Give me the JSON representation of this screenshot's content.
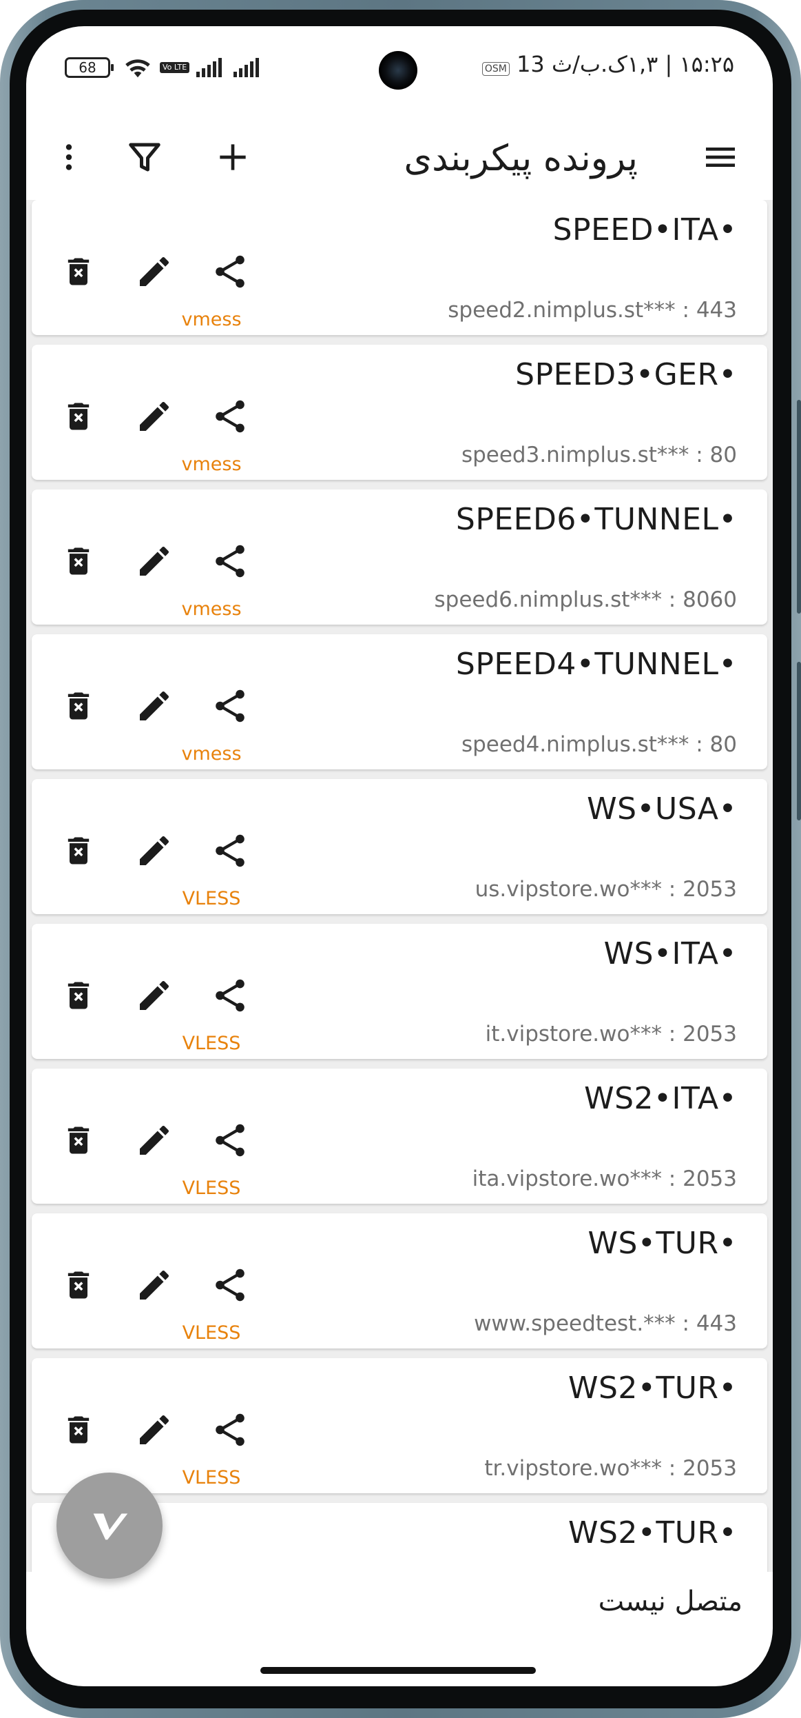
{
  "status_bar": {
    "battery": "68",
    "volte": "Vo LTE",
    "time_date": "۱۵:۲۵ | ۱,۳ک.ب/ث",
    "osm_badge": "OSM",
    "notif_count": "13"
  },
  "app_bar": {
    "title": "پرونده پیکربندی",
    "icons": [
      "menu-icon",
      "add-icon",
      "filter-icon",
      "more-vert-icon"
    ]
  },
  "servers": [
    {
      "name": "SPEED•ITA•",
      "address": "speed2.nimplus.st*** : 443",
      "type": "vmess"
    },
    {
      "name": "SPEED3•GER•",
      "address": "speed3.nimplus.st*** : 80",
      "type": "vmess"
    },
    {
      "name": "SPEED6•TUNNEL•",
      "address": "speed6.nimplus.st*** : 8060",
      "type": "vmess"
    },
    {
      "name": "SPEED4•TUNNEL•",
      "address": "speed4.nimplus.st*** : 80",
      "type": "vmess"
    },
    {
      "name": "WS•USA•",
      "address": "us.vipstore.wo*** : 2053",
      "type": "VLESS"
    },
    {
      "name": "WS•ITA•",
      "address": "it.vipstore.wo*** : 2053",
      "type": "VLESS"
    },
    {
      "name": "WS2•ITA•",
      "address": "ita.vipstore.wo*** : 2053",
      "type": "VLESS"
    },
    {
      "name": "WS•TUR•",
      "address": "www.speedtest.*** : 443",
      "type": "VLESS"
    },
    {
      "name": "WS2•TUR•",
      "address": "tr.vipstore.wo*** : 2053",
      "type": "VLESS"
    },
    {
      "name": "WS2•TUR•",
      "address": "",
      "type": ""
    }
  ],
  "card_icons": [
    "share-icon",
    "edit-icon",
    "delete-icon"
  ],
  "bottom": {
    "connection_status": "متصل نیست",
    "fab_icon": "v-logo-icon"
  },
  "colors": {
    "accent": "#e8820c",
    "fab": "#9e9e9e",
    "list_background": "#eeeeee"
  }
}
